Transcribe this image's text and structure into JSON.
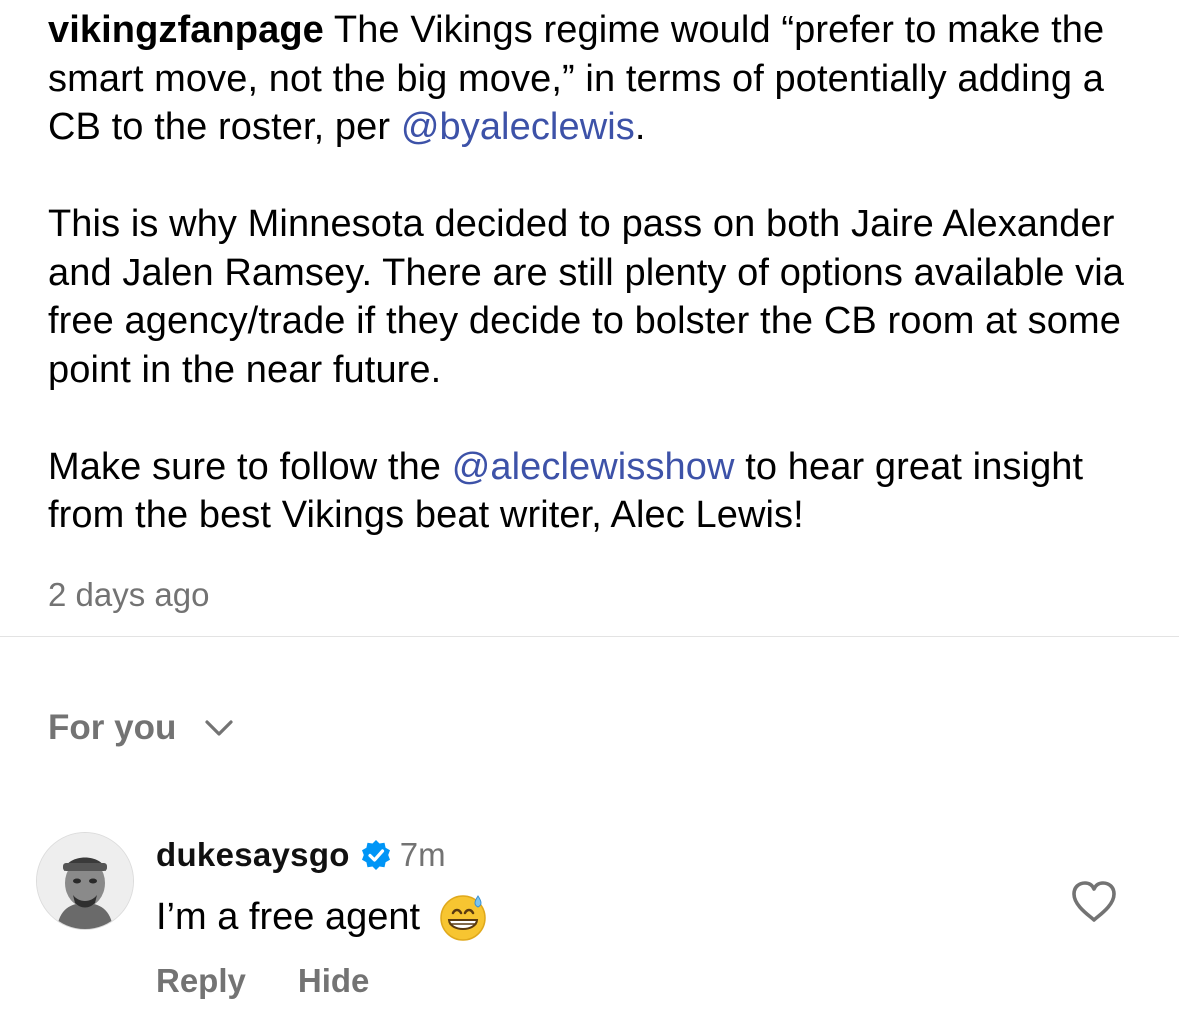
{
  "post": {
    "username": "vikingzfanpage",
    "paragraph1_text": " The Vikings regime would “prefer to make the smart move, not the big move,” in terms of potentially adding a CB to the roster, per ",
    "paragraph1_mention": "@byaleclewis",
    "paragraph1_end": ".",
    "paragraph2": "This is why Minnesota decided to pass on both Jaire Alexander and Jalen Ramsey. There are still plenty of options available via free agency/trade if they decide to bolster the CB room at some point in the near future.",
    "paragraph3_start": "Make sure to follow the ",
    "paragraph3_mention": "@aleclewisshow",
    "paragraph3_end": " to hear great insight from the best Vikings beat writer, Alec Lewis!",
    "timestamp": "2 days ago"
  },
  "sort": {
    "label": "For you",
    "icon": "chevron-down-icon"
  },
  "comment": {
    "username": "dukesaysgo",
    "verified_icon": "verified-badge-icon",
    "time": "7m",
    "text": "I’m a free agent",
    "emoji": "grinning-face-with-sweat-emoji",
    "like_icon": "heart-icon",
    "reply_label": "Reply",
    "hide_label": "Hide"
  },
  "colors": {
    "mention": "#3d52a8",
    "secondary_text": "#737373",
    "verified": "#0095f6"
  }
}
